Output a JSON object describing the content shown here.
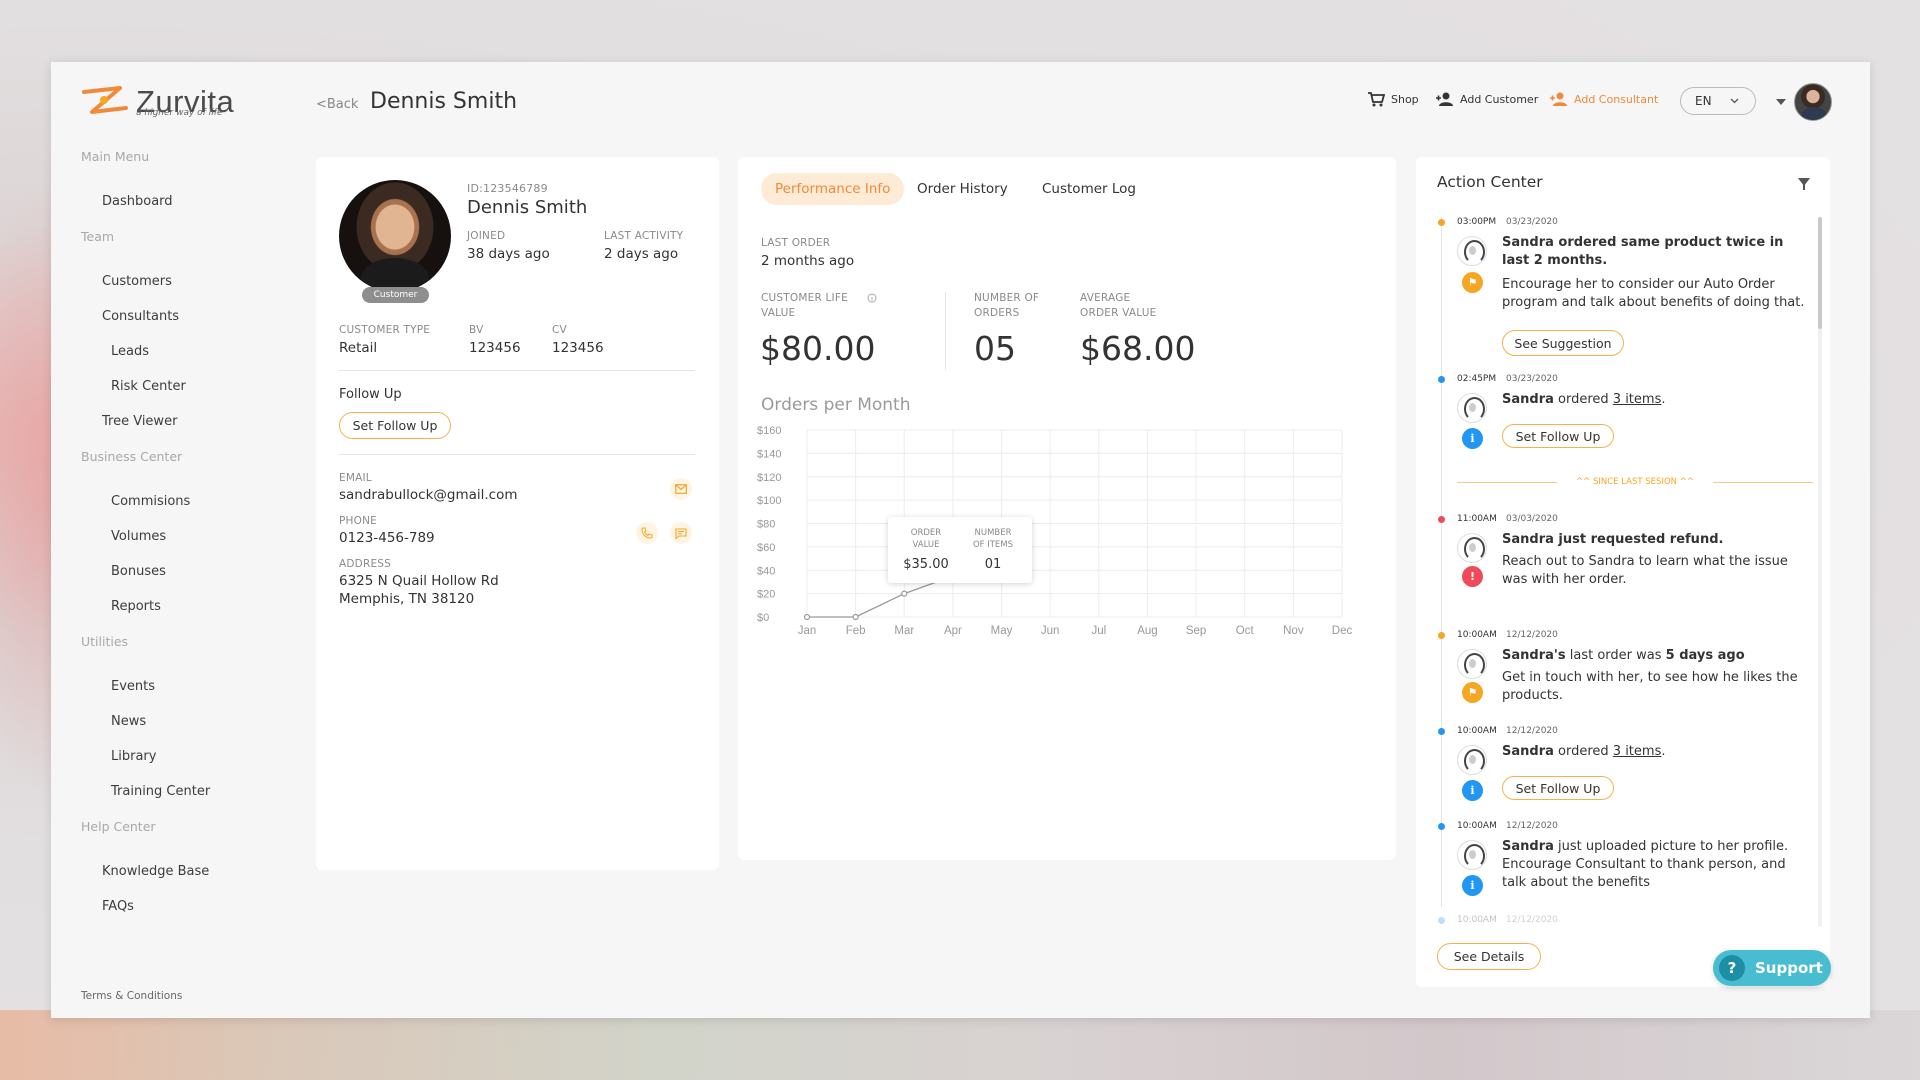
{
  "app": {
    "logo_text": "Zurvita",
    "logo_tagline": "a higher way of life"
  },
  "colors": {
    "accent": "#f5a623",
    "accent_orange": "#f08a3a",
    "info_blue": "#2196f3",
    "alert_red": "#ef4a5a",
    "support": "#48bcd1"
  },
  "sidebar": {
    "main_menu_label": "Main Menu",
    "dashboard": "Dashboard",
    "team_label": "Team",
    "customers": "Customers",
    "consultants": "Consultants",
    "leads": "Leads",
    "risk_center": "Risk Center",
    "tree_viewer": "Tree Viewer",
    "business_center_label": "Business Center",
    "commisions": "Commisions",
    "volumes": "Volumes",
    "bonuses": "Bonuses",
    "reports": "Reports",
    "utilities_label": "Utilities",
    "events": "Events",
    "news": "News",
    "library": "Library",
    "training_center": "Training Center",
    "help_center_label": "Help Center",
    "knowledge_base": "Knowledge Base",
    "faqs": "FAQs",
    "terms": "Terms & Conditions"
  },
  "header": {
    "back": "<Back",
    "title": "Dennis Smith",
    "shop": "Shop",
    "add_customer": "Add Customer",
    "add_consultant": "Add Consultant",
    "language": "EN"
  },
  "profile": {
    "id": "ID:123546789",
    "name": "Dennis Smith",
    "badge": "Customer",
    "joined_label": "JOINED",
    "joined_value": "38 days ago",
    "last_activity_label": "LAST ACTIVITY",
    "last_activity_value": "2 days ago",
    "customer_type_label": "CUSTOMER TYPE",
    "customer_type_value": "Retail",
    "bv_label": "BV",
    "bv_value": "123456",
    "cv_label": "CV",
    "cv_value": "123456",
    "follow_up_label": "Follow Up",
    "set_follow_up": "Set Follow Up",
    "email_label": "EMAIL",
    "email_value": "sandrabullock@gmail.com",
    "phone_label": "PHONE",
    "phone_value": "0123-456-789",
    "address_label": "ADDRESS",
    "address_line1": "6325 N Quail Hollow Rd",
    "address_line2": "Memphis,  TN 38120"
  },
  "performance": {
    "tabs": [
      "Performance Info",
      "Order History",
      "Customer Log"
    ],
    "last_order_label": "LAST ORDER",
    "last_order_value": "2 months ago",
    "clv_label_1": "CUSTOMER LIFE",
    "clv_label_2": "VALUE",
    "clv_value": "$80.00",
    "orders_label_1": "NUMBER OF",
    "orders_label_2": "ORDERS",
    "orders_value": "05",
    "aov_label_1": "AVERAGE",
    "aov_label_2": "ORDER VALUE",
    "aov_value": "$68.00",
    "chart_title": "Orders per Month",
    "tooltip": {
      "order_value_label_1": "ORDER",
      "order_value_label_2": "VALUE",
      "order_value": "$35.00",
      "items_label_1": "NUMBER",
      "items_label_2": "OF ITEMS",
      "items_value": "01"
    }
  },
  "chart_data": {
    "type": "line",
    "title": "Orders per Month",
    "categories": [
      "Jan",
      "Feb",
      "Mar",
      "Apr",
      "May",
      "Jun",
      "Jul",
      "Aug",
      "Sep",
      "Oct",
      "Nov",
      "Dec"
    ],
    "values": [
      0,
      0,
      20,
      35,
      null,
      null,
      null,
      null,
      null,
      null,
      null,
      null
    ],
    "yticks": [
      "$0",
      "$20",
      "$40",
      "$60",
      "$80",
      "$100",
      "$120",
      "$140",
      "$160"
    ],
    "ylim": [
      0,
      160
    ],
    "grid": true
  },
  "action_center": {
    "title": "Action Center",
    "since_last_session": "^^ SINCE LAST SESION ^^",
    "see_details": "See Details",
    "events": [
      {
        "time": "03:00PM",
        "date": "03/23/2020",
        "bold": "Sandra ordered same product twice in last 2 months.",
        "text": "Encourage her to consider our Auto Order program and talk about benefits of doing that.",
        "button": "See Suggestion",
        "badge": "flag",
        "dot_color": "#f5a623",
        "badge_color": "#f5a623"
      },
      {
        "time": "02:45PM",
        "date": "03/23/2020",
        "bold": "Sandra",
        "text_mid": " ordered ",
        "link": "3 items",
        "text_end": ".",
        "button": "Set Follow Up",
        "badge": "info",
        "dot_color": "#2196f3",
        "badge_color": "#2196f3"
      },
      {
        "time": "11:00AM",
        "date": "03/03/2020",
        "bold": "Sandra just requested refund.",
        "text": "Reach out to Sandra to learn what the issue was with her order.",
        "badge": "alert",
        "dot_color": "#ef4a5a",
        "badge_color": "#ef4a5a"
      },
      {
        "time": "10:00AM",
        "date": "12/12/2020",
        "bold": "Sandra's",
        "text_mid": " last order was ",
        "bold2": "5 days ago",
        "text": "Get in touch with her, to see how he likes the products.",
        "badge": "flag",
        "dot_color": "#f5a623",
        "badge_color": "#f5a623"
      },
      {
        "time": "10:00AM",
        "date": "12/12/2020",
        "bold": "Sandra",
        "text_mid": " ordered ",
        "link": "3 items",
        "text_end": ".",
        "button": "Set Follow Up",
        "badge": "info",
        "dot_color": "#2196f3",
        "badge_color": "#2196f3"
      },
      {
        "time": "10:00AM",
        "date": "12/12/2020",
        "bold": "Sandra",
        "text_mid": " just uploaded picture to her profile. Encourage Consultant to thank person, and talk about the benefits",
        "badge": "info",
        "dot_color": "#2196f3",
        "badge_color": "#2196f3"
      },
      {
        "time": "10:00AM",
        "date": "12/12/2020"
      }
    ]
  },
  "support": {
    "label": "Support",
    "icon": "?"
  }
}
